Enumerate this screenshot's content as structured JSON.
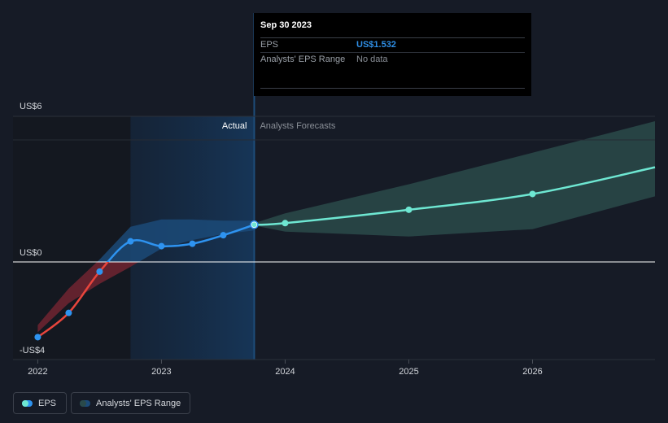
{
  "colors": {
    "background": "#161b26",
    "actual_line": "#2e93f0",
    "negative_line": "#e8453c",
    "forecast_line": "#6ee7d2",
    "forecast_band": "#2a4a4a",
    "past_band": "#1b4a78",
    "negative_band": "#6a2430"
  },
  "tooltip": {
    "date": "Sep 30 2023",
    "eps_label": "EPS",
    "eps_value": "US$1.532",
    "range_label": "Analysts' EPS Range",
    "range_value": "No data"
  },
  "legend": {
    "eps": "EPS",
    "range": "Analysts' EPS Range"
  },
  "chart_data": {
    "type": "line",
    "y_tick_labels": [
      "US$6",
      "US$0",
      "-US$4"
    ],
    "ylim": [
      -4.2,
      6
    ],
    "xlim": [
      2021.8,
      2026.99
    ],
    "x_ticks": [
      2022,
      2023,
      2024,
      2025,
      2026
    ],
    "x_tick_labels": [
      "2022",
      "2023",
      "2024",
      "2025",
      "2026"
    ],
    "region_labels": {
      "actual": "Actual",
      "forecast": "Analysts Forecasts"
    },
    "actual_region_start": 2022.75,
    "forecast_start": 2023.75,
    "series": [
      {
        "name": "EPS",
        "x": [
          2022.0,
          2022.25,
          2022.5,
          2022.75,
          2023.0,
          2023.25,
          2023.5,
          2023.75
        ],
        "values": [
          -3.1,
          -2.1,
          -0.4,
          0.85,
          0.65,
          0.75,
          1.1,
          1.532
        ]
      },
      {
        "name": "EPS forecast",
        "x": [
          2023.75,
          2024.0,
          2025.0,
          2026.0,
          2026.99
        ],
        "values": [
          1.532,
          1.6,
          2.15,
          2.8,
          3.9
        ]
      }
    ],
    "range_band": {
      "x": [
        2022.0,
        2022.25,
        2022.5,
        2022.75,
        2023.0,
        2023.25,
        2023.5,
        2023.75
      ],
      "low": [
        -2.9,
        -1.7,
        -0.9,
        -0.2,
        0.55,
        0.9,
        1.15,
        1.3
      ],
      "high": [
        -2.6,
        -1.1,
        0.1,
        1.45,
        1.75,
        1.75,
        1.7,
        1.7
      ]
    },
    "forecast_band": {
      "x": [
        2023.75,
        2024.0,
        2025.0,
        2026.0,
        2026.99
      ],
      "low": [
        1.5,
        1.25,
        1.05,
        1.35,
        2.7
      ],
      "high": [
        1.6,
        2.0,
        3.2,
        4.5,
        5.8
      ]
    }
  }
}
